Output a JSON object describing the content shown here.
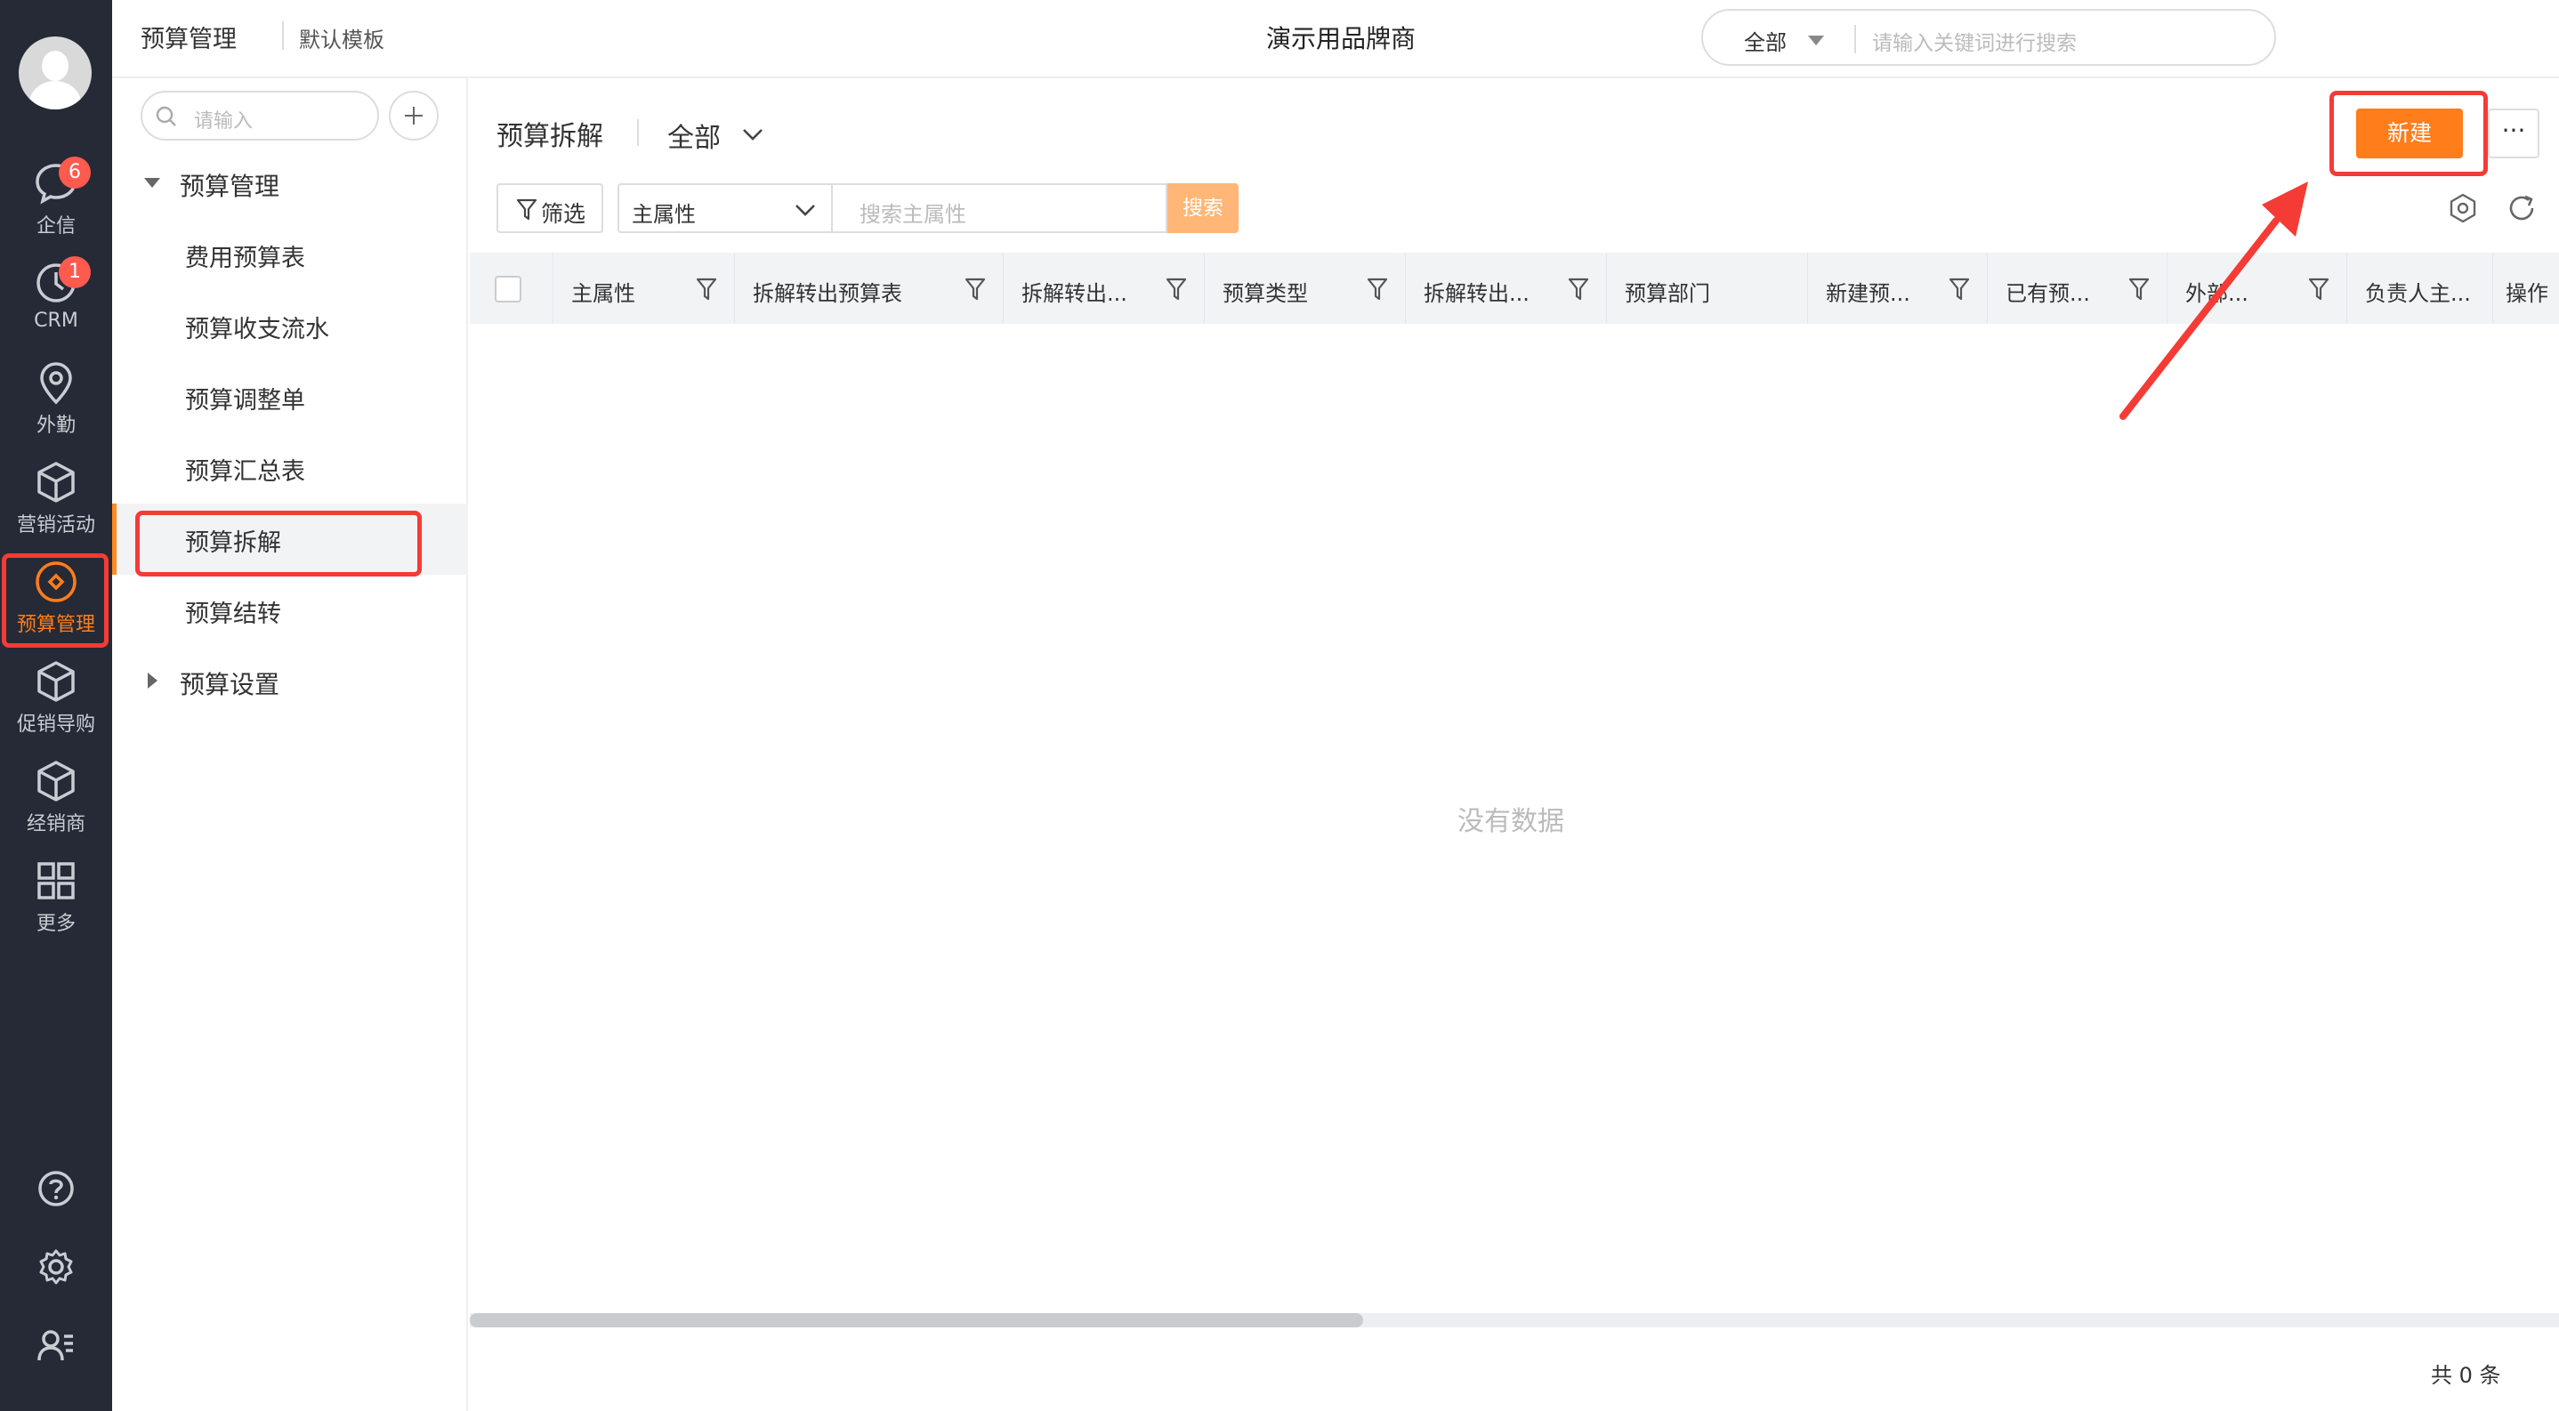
{
  "rail": {
    "items": [
      {
        "label": "企信",
        "badge": "6",
        "icon": "chat-icon"
      },
      {
        "label": "CRM",
        "badge": "1",
        "icon": "clock-icon"
      },
      {
        "label": "外勤",
        "icon": "location-pin-icon"
      },
      {
        "label": "营销活动",
        "icon": "cube-icon"
      },
      {
        "label": "预算管理",
        "icon": "budget-icon",
        "active": true
      },
      {
        "label": "促销导购",
        "icon": "cube-icon"
      },
      {
        "label": "经销商",
        "icon": "cube-icon"
      },
      {
        "label": "更多",
        "icon": "grid-icon"
      }
    ],
    "bottom_icons": [
      "help-icon",
      "settings-icon",
      "user-list-icon"
    ]
  },
  "header": {
    "crumb_app": "预算管理",
    "crumb_template": "默认模板",
    "brand": "演示用品牌商",
    "search_scope": "全部",
    "search_placeholder": "请输入关键词进行搜索"
  },
  "sidebar": {
    "search_placeholder": "请输入",
    "groups": [
      {
        "label": "预算管理",
        "expanded": true
      },
      {
        "label": "预算设置",
        "expanded": false
      }
    ],
    "items": [
      {
        "label": "费用预算表"
      },
      {
        "label": "预算收支流水"
      },
      {
        "label": "预算调整单"
      },
      {
        "label": "预算汇总表"
      },
      {
        "label": "预算拆解",
        "active": true
      },
      {
        "label": "预算结转"
      }
    ]
  },
  "main": {
    "title": "预算拆解",
    "scope": "全部",
    "new_label": "新建",
    "more_label": "···",
    "filter_label": "筛选",
    "attr_select": "主属性",
    "attr_placeholder": "搜索主属性",
    "search_label": "搜索",
    "columns": [
      {
        "label": "主属性"
      },
      {
        "label": "拆解转出预算表"
      },
      {
        "label": "拆解转出..."
      },
      {
        "label": "预算类型"
      },
      {
        "label": "拆解转出..."
      },
      {
        "label": "预算部门"
      },
      {
        "label": "新建预..."
      },
      {
        "label": "已有预..."
      },
      {
        "label": "外部..."
      },
      {
        "label": "负责人主..."
      },
      {
        "label": "操作"
      }
    ],
    "empty_text": "没有数据",
    "total_text": "共 0 条"
  },
  "colors": {
    "accent": "#ff7d1a",
    "highlight": "#f53b36",
    "rail_bg": "#252a36"
  }
}
